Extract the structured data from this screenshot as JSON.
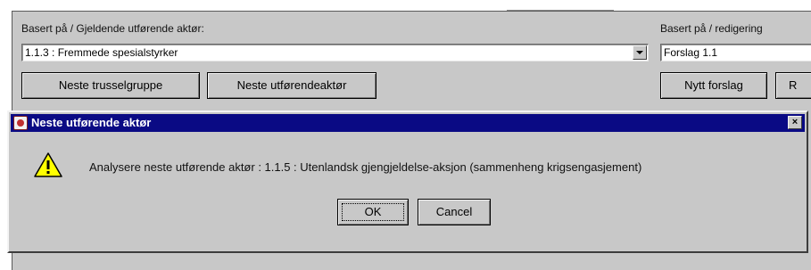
{
  "form": {
    "actor_label": "Basert på / Gjeldende utførende aktør:",
    "actor_value": "1.1.3 : Fremmede spesialstyrker",
    "edit_label": "Basert på / redigering",
    "edit_value": "Forslag 1.1",
    "buttons": {
      "next_threat_group": "Neste trusselgruppe",
      "next_actor": "Neste utførendeaktør",
      "new_proposal": "Nytt forslag",
      "partial_right": "R"
    }
  },
  "dialog": {
    "title": "Neste utførende aktør",
    "close_glyph": "×",
    "message": "Analysere neste utførende aktør : 1.1.5 : Utenlandsk gjengjeldelse-aksjon (sammenheng krigsengasjement)",
    "ok_label": "OK",
    "cancel_label": "Cancel",
    "icon": "warning-icon"
  },
  "colors": {
    "background": "#c8c8c8",
    "titlebar": "#0a0a84",
    "warning_fill": "#ffff00"
  }
}
